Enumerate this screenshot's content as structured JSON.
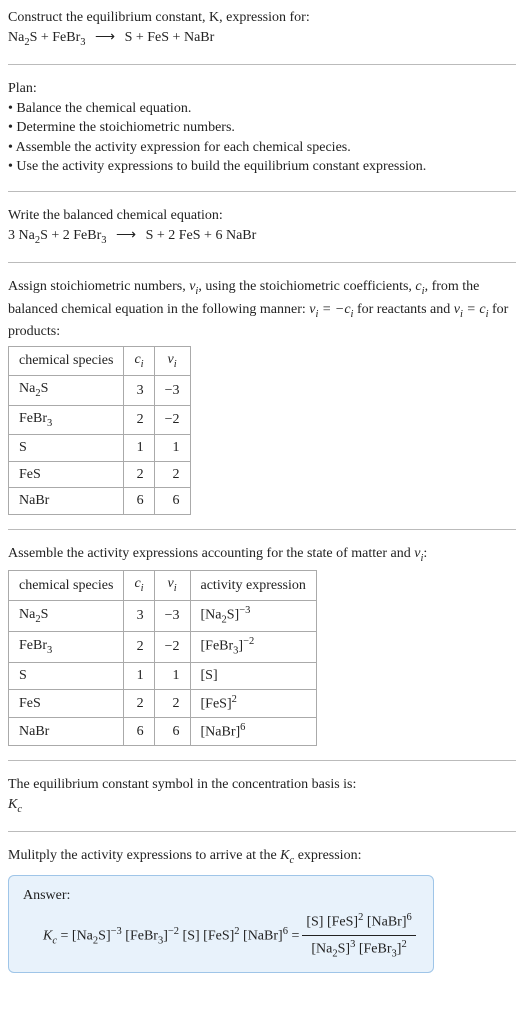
{
  "header": {
    "prompt_line1": "Construct the equilibrium constant, K, expression for:",
    "eq_lhs_1": "Na",
    "eq_lhs_1_sub": "2",
    "eq_lhs_1b": "S + FeBr",
    "eq_lhs_1b_sub": "3",
    "arrow": "⟶",
    "eq_rhs": "S + FeS + NaBr"
  },
  "plan": {
    "title": "Plan:",
    "b1": "• Balance the chemical equation.",
    "b2": "• Determine the stoichiometric numbers.",
    "b3": "• Assemble the activity expression for each chemical species.",
    "b4": "• Use the activity expressions to build the equilibrium constant expression."
  },
  "balanced": {
    "intro": "Write the balanced chemical equation:",
    "lhs_3": "3 Na",
    "lhs_3_sub": "2",
    "lhs_3b": "S + 2 FeBr",
    "lhs_3b_sub": "3",
    "arrow": "⟶",
    "rhs": "S + 2 FeS + 6 NaBr"
  },
  "stoich_intro": {
    "p1a": "Assign stoichiometric numbers, ",
    "p1b": ", using the stoichiometric coefficients, ",
    "p1c": ", from the balanced chemical equation in the following manner: ",
    "p1d": " for reactants and ",
    "p1e": " for products:",
    "nu_i": "ν",
    "nu_i_sub": "i",
    "c_i": "c",
    "c_i_sub": "i",
    "eq_react": "ν",
    "eq_react_sub": "i",
    "eq_react_mid": " = −c",
    "eq_react_sub2": "i",
    "eq_prod": "ν",
    "eq_prod_sub": "i",
    "eq_prod_mid": " = c",
    "eq_prod_sub2": "i"
  },
  "table1": {
    "h1": "chemical species",
    "h2": "c",
    "h2_sub": "i",
    "h3": "ν",
    "h3_sub": "i",
    "r1_s": "Na",
    "r1_s_sub": "2",
    "r1_s2": "S",
    "r1_c": "3",
    "r1_v": "−3",
    "r2_s": "FeBr",
    "r2_s_sub": "3",
    "r2_c": "2",
    "r2_v": "−2",
    "r3_s": "S",
    "r3_c": "1",
    "r3_v": "1",
    "r4_s": "FeS",
    "r4_c": "2",
    "r4_v": "2",
    "r5_s": "NaBr",
    "r5_c": "6",
    "r5_v": "6"
  },
  "activity_intro": {
    "p1": "Assemble the activity expressions accounting for the state of matter and ",
    "nu": "ν",
    "nu_sub": "i",
    "colon": ":"
  },
  "table2": {
    "h1": "chemical species",
    "h2": "c",
    "h2_sub": "i",
    "h3": "ν",
    "h3_sub": "i",
    "h4": "activity expression",
    "r1_s": "Na",
    "r1_s_sub": "2",
    "r1_s2": "S",
    "r1_c": "3",
    "r1_v": "−3",
    "r1_a": "[Na",
    "r1_a_sub": "2",
    "r1_a2": "S]",
    "r1_a_sup": "−3",
    "r2_s": "FeBr",
    "r2_s_sub": "3",
    "r2_c": "2",
    "r2_v": "−2",
    "r2_a": "[FeBr",
    "r2_a_sub": "3",
    "r2_a2": "]",
    "r2_a_sup": "−2",
    "r3_s": "S",
    "r3_c": "1",
    "r3_v": "1",
    "r3_a": "[S]",
    "r4_s": "FeS",
    "r4_c": "2",
    "r4_v": "2",
    "r4_a": "[FeS]",
    "r4_a_sup": "2",
    "r5_s": "NaBr",
    "r5_c": "6",
    "r5_v": "6",
    "r5_a": "[NaBr]",
    "r5_a_sup": "6"
  },
  "kc_symbol": {
    "p": "The equilibrium constant symbol in the concentration basis is:",
    "k": "K",
    "k_sub": "c"
  },
  "multiply": {
    "p1": "Mulitply the activity expressions to arrive at the ",
    "k": "K",
    "k_sub": "c",
    "p2": " expression:"
  },
  "answer": {
    "label": "Answer:",
    "k": "K",
    "k_sub": "c",
    "eq": " = [Na",
    "eq_sub1": "2",
    "eq2": "S]",
    "eq_sup1": "−3",
    "eq3": " [FeBr",
    "eq_sub2": "3",
    "eq4": "]",
    "eq_sup2": "−2",
    "eq5": " [S] [FeS]",
    "eq_sup3": "2",
    "eq6": " [NaBr]",
    "eq_sup4": "6",
    "eq7": " = ",
    "num1": "[S] [FeS]",
    "num_sup1": "2",
    "num2": " [NaBr]",
    "num_sup2": "6",
    "den1": "[Na",
    "den_sub1": "2",
    "den2": "S]",
    "den_sup1": "3",
    "den3": " [FeBr",
    "den_sub2": "3",
    "den4": "]",
    "den_sup2": "2"
  },
  "chart_data": {
    "type": "table",
    "title": "Stoichiometric numbers and activity expressions",
    "columns": [
      "chemical species",
      "c_i",
      "ν_i",
      "activity expression"
    ],
    "rows": [
      [
        "Na2S",
        3,
        -3,
        "[Na2S]^-3"
      ],
      [
        "FeBr3",
        2,
        -2,
        "[FeBr3]^-2"
      ],
      [
        "S",
        1,
        1,
        "[S]"
      ],
      [
        "FeS",
        2,
        2,
        "[FeS]^2"
      ],
      [
        "NaBr",
        6,
        6,
        "[NaBr]^6"
      ]
    ],
    "balanced_equation": "3 Na2S + 2 FeBr3 ⟶ S + 2 FeS + 6 NaBr",
    "Kc_expression": "[S][FeS]^2[NaBr]^6 / ([Na2S]^3 [FeBr3]^2)"
  }
}
